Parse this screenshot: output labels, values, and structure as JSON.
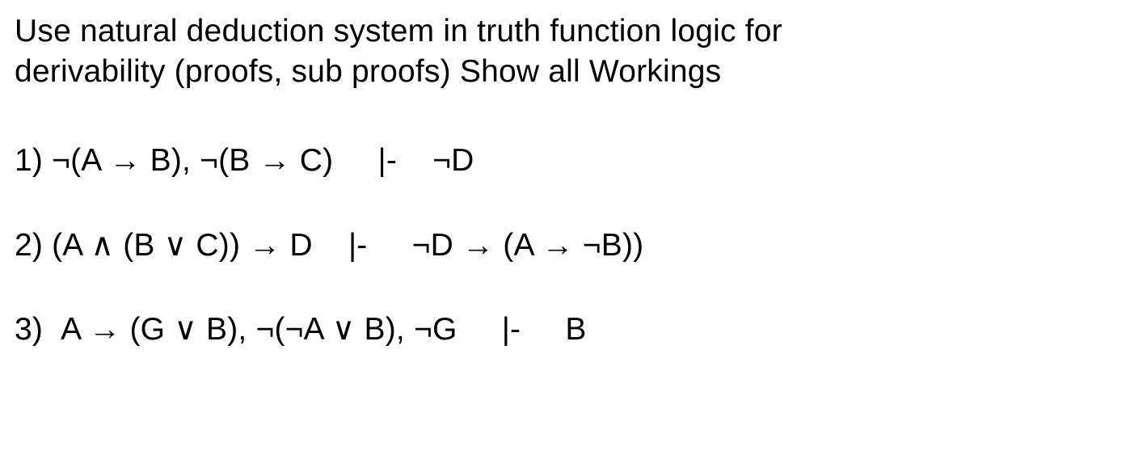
{
  "intro": {
    "line1": "Use natural deduction system in truth function logic for",
    "line2": "derivability (proofs, sub proofs) Show all Workings"
  },
  "problems": {
    "p1": {
      "label": "1)",
      "premises": "¬(A → B), ¬(B → C)",
      "turnstile": "|-",
      "conclusion": "¬D"
    },
    "p2": {
      "label": "2)",
      "premises": "(A ∧ (B ∨ C)) → D",
      "turnstile": "|-",
      "conclusion": "¬D → (A → ¬B))"
    },
    "p3": {
      "label": "3)",
      "premises": "A → (G ∨ B), ¬(¬A ∨ B), ¬G",
      "turnstile": "|-",
      "conclusion": "B"
    }
  }
}
